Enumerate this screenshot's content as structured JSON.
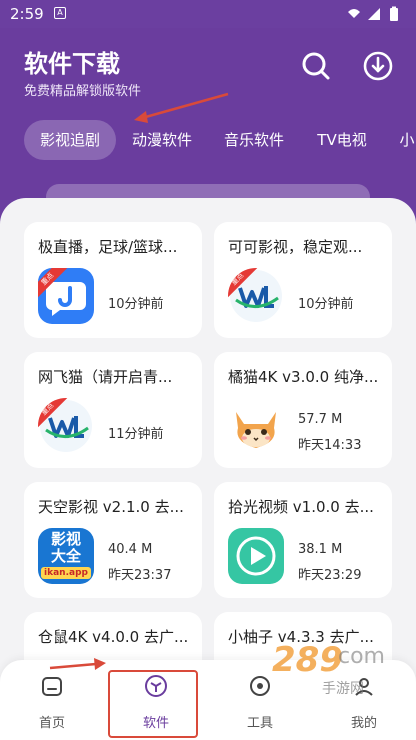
{
  "status": {
    "time": "2:59",
    "notif_glyph": "A"
  },
  "header": {
    "title": "软件下载",
    "subtitle": "免费精品解锁版软件",
    "search_icon": "search-icon",
    "download_icon": "download-icon"
  },
  "tabs": [
    {
      "label": "影视追剧",
      "active": true
    },
    {
      "label": "动漫软件",
      "active": false
    },
    {
      "label": "音乐软件",
      "active": false
    },
    {
      "label": "TV电视",
      "active": false
    },
    {
      "label": "小",
      "active": false
    }
  ],
  "cards": [
    {
      "title": "极直播，足球/篮球...",
      "meta1": "10分钟前",
      "meta2": "",
      "icon": "jizhibo-icon",
      "ribbon": "重点"
    },
    {
      "title": "可可影视，稳定观...",
      "meta1": "10分钟前",
      "meta2": "",
      "icon": "wl-icon",
      "ribbon": "重点"
    },
    {
      "title": "网飞猫（请开启青...",
      "meta1": "11分钟前",
      "meta2": "",
      "icon": "wl-icon",
      "ribbon": "重点"
    },
    {
      "title": "橘猫4K v3.0.0 纯净...",
      "meta1": "57.7 M",
      "meta2": "昨天14:33",
      "icon": "cat-icon",
      "ribbon": ""
    },
    {
      "title": "天空影视 v2.1.0 去...",
      "meta1": "40.4 M",
      "meta2": "昨天23:37",
      "icon": "ikan-icon",
      "ribbon": "",
      "icon_text": [
        "影视",
        "大全",
        "ikan.app"
      ]
    },
    {
      "title": "拾光视频 v1.0.0 去...",
      "meta1": "38.1 M",
      "meta2": "昨天23:29",
      "icon": "play-icon",
      "ribbon": ""
    },
    {
      "title": "仓鼠4K v4.0.0 去广...",
      "meta1": "",
      "meta2": "",
      "icon": "",
      "ribbon": ""
    },
    {
      "title": "小柚子 v4.3.3 去广...",
      "meta1": "",
      "meta2": "",
      "icon": "",
      "ribbon": ""
    }
  ],
  "bottom_nav": [
    {
      "label": "首页",
      "icon": "home-icon",
      "active": false
    },
    {
      "label": "软件",
      "icon": "cube-icon",
      "active": true
    },
    {
      "label": "工具",
      "icon": "tools-icon",
      "active": false
    },
    {
      "label": "我的",
      "icon": "profile-icon",
      "active": false
    }
  ],
  "watermark": {
    "text": "289",
    "suffix": "手游网",
    "domain": "com"
  },
  "colors": {
    "brand": "#6a3d9e",
    "annotation": "#d94a3a",
    "ribbon": "#e53935"
  }
}
